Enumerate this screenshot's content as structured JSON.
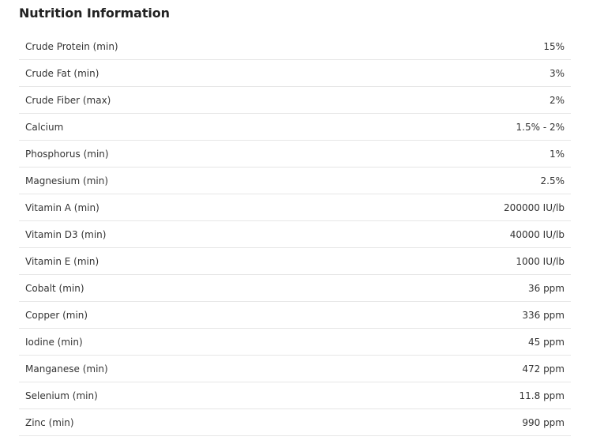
{
  "title": "Nutrition Information",
  "rows": [
    {
      "label": "Crude Protein (min)",
      "value": "15%"
    },
    {
      "label": "Crude Fat (min)",
      "value": "3%"
    },
    {
      "label": "Crude Fiber (max)",
      "value": "2%"
    },
    {
      "label": "Calcium",
      "value": "1.5% - 2%"
    },
    {
      "label": "Phosphorus (min)",
      "value": "1%"
    },
    {
      "label": "Magnesium (min)",
      "value": "2.5%"
    },
    {
      "label": "Vitamin A (min)",
      "value": "200000 IU/lb"
    },
    {
      "label": "Vitamin D3 (min)",
      "value": "40000 IU/lb"
    },
    {
      "label": "Vitamin E (min)",
      "value": "1000 IU/lb"
    },
    {
      "label": "Cobalt (min)",
      "value": "36 ppm"
    },
    {
      "label": "Copper (min)",
      "value": "336 ppm"
    },
    {
      "label": "Iodine (min)",
      "value": "45 ppm"
    },
    {
      "label": "Manganese (min)",
      "value": "472 ppm"
    },
    {
      "label": "Selenium (min)",
      "value": "11.8 ppm"
    },
    {
      "label": "Zinc (min)",
      "value": "990 ppm"
    }
  ]
}
